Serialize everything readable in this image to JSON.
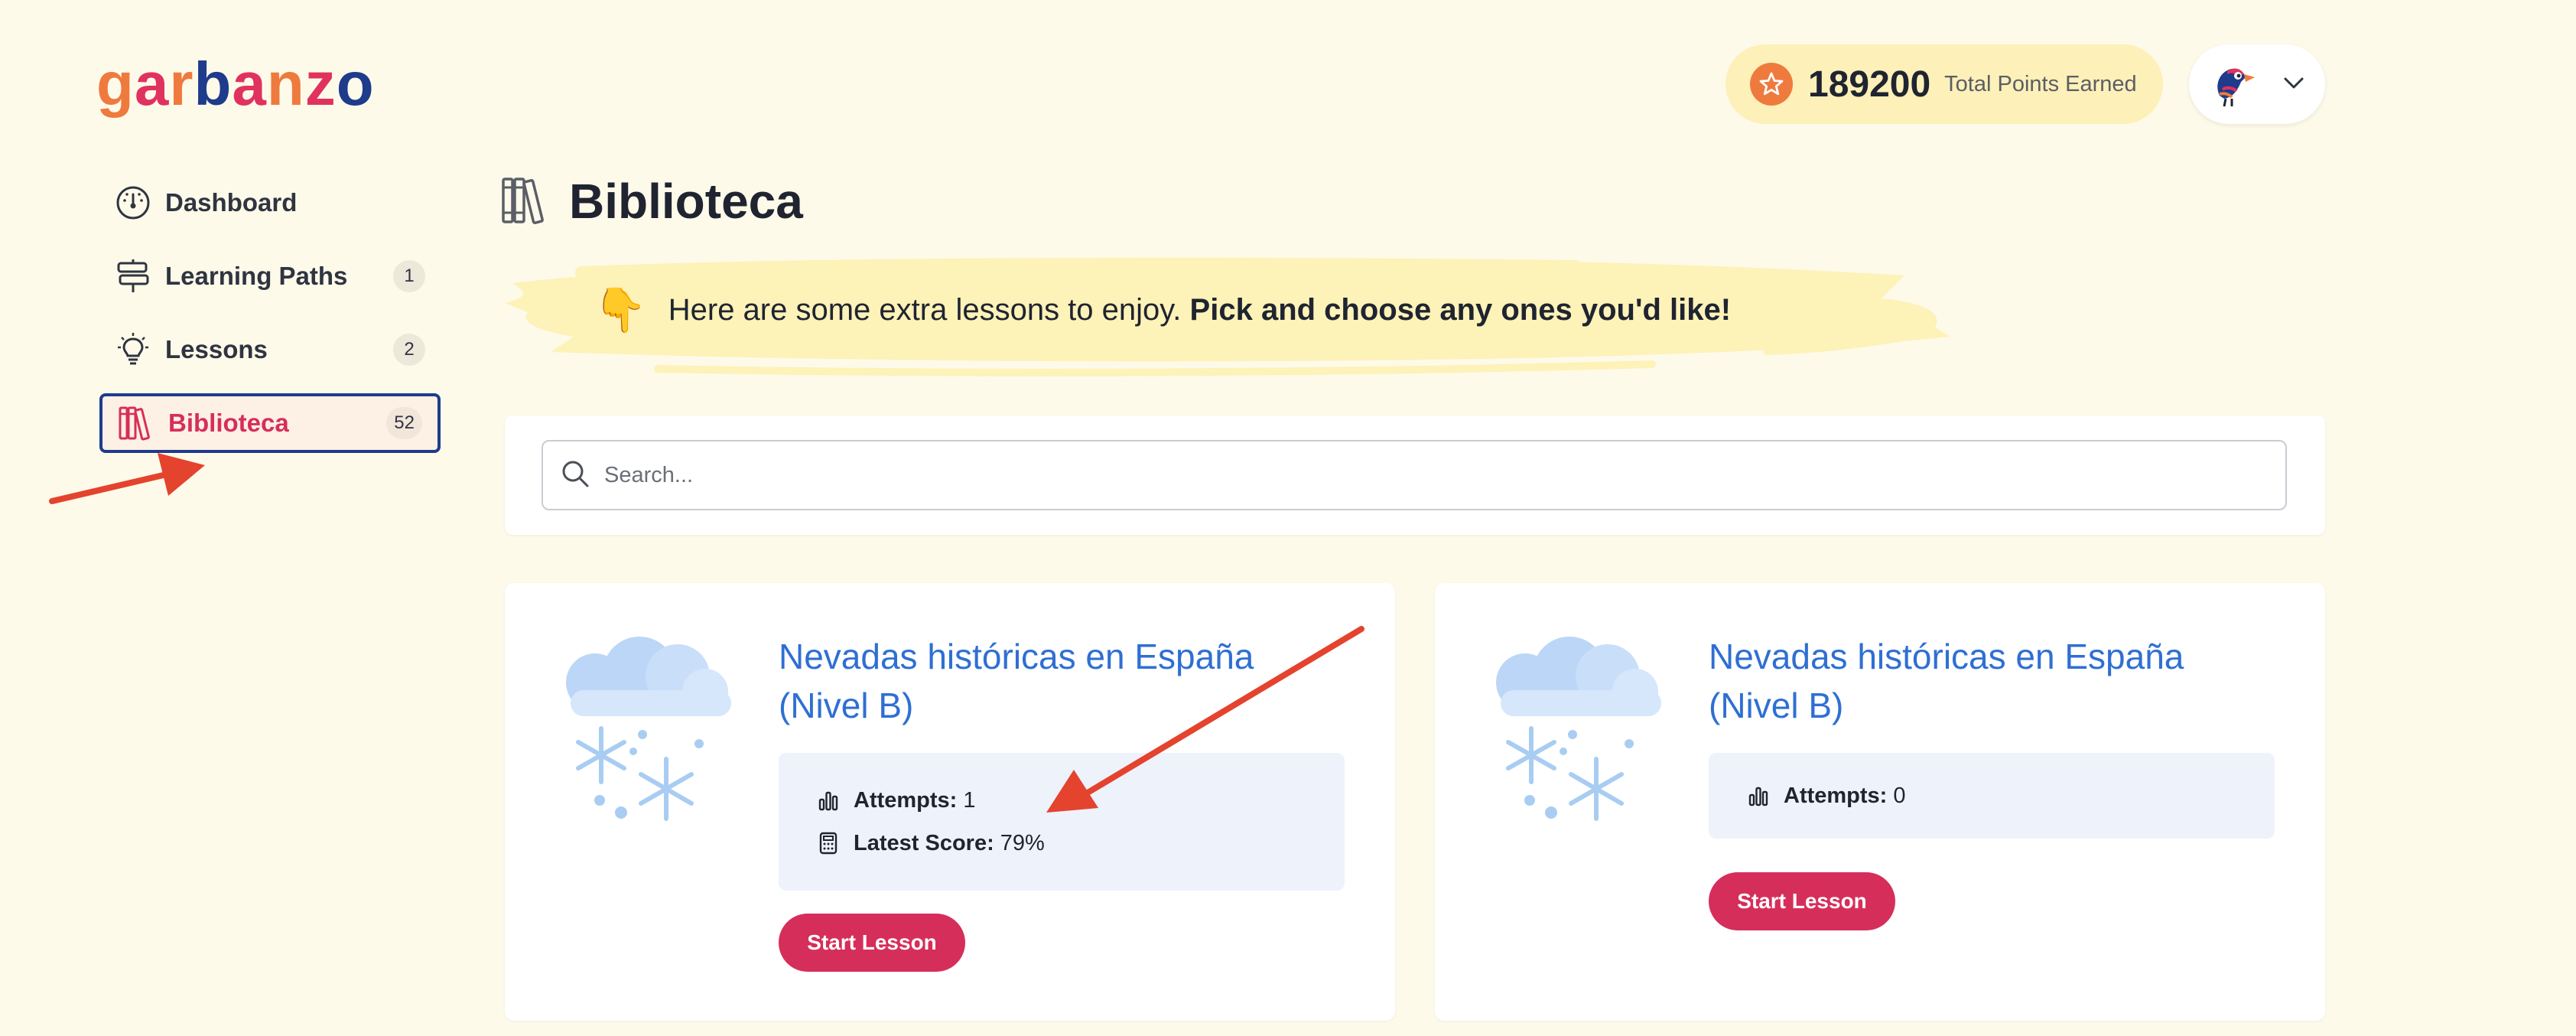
{
  "logo": {
    "letters": [
      {
        "ch": "g",
        "color": "#ef7a3d"
      },
      {
        "ch": "a",
        "color": "#e0325f"
      },
      {
        "ch": "r",
        "color": "#ef7a3d"
      },
      {
        "ch": "b",
        "color": "#1e3b8c"
      },
      {
        "ch": "a",
        "color": "#e0325f"
      },
      {
        "ch": "n",
        "color": "#ef7a3d"
      },
      {
        "ch": "z",
        "color": "#e0325f"
      },
      {
        "ch": "o",
        "color": "#1e3b8c"
      }
    ]
  },
  "sidebar": {
    "items": [
      {
        "label": "Dashboard",
        "icon": "dashboard-gauge-icon",
        "count": ""
      },
      {
        "label": "Learning Paths",
        "icon": "signpost-icon",
        "count": "1"
      },
      {
        "label": "Lessons",
        "icon": "lightbulb-icon",
        "count": "2"
      },
      {
        "label": "Biblioteca",
        "icon": "books-icon",
        "count": "52",
        "active": true
      }
    ]
  },
  "header": {
    "points_value": "189200",
    "points_label": "Total Points Earned",
    "points_icon": "star-icon",
    "avatar_icon": "bird-avatar-icon",
    "menu_icon": "chevron-down-icon"
  },
  "page": {
    "title": "Biblioteca",
    "title_icon": "books-icon",
    "banner_hand": "👇",
    "banner_text": "Here are some extra lessons to enjoy.",
    "banner_bold": "Pick and choose any ones you'd like!"
  },
  "search": {
    "placeholder": "Search...",
    "value": ""
  },
  "lessons": [
    {
      "title": "Nevadas históricas en España (Nivel B)",
      "illustration": "snow-cloud-icon",
      "attempts_label": "Attempts:",
      "attempts_value": "1",
      "score_label": "Latest Score:",
      "score_value": "79%",
      "button": "Start Lesson"
    },
    {
      "title": "Nevadas históricas en España (Nivel B)",
      "illustration": "snow-cloud-icon",
      "attempts_label": "Attempts:",
      "attempts_value": "0",
      "button": "Start Lesson"
    }
  ],
  "colors": {
    "background": "#fefaea",
    "accent": "#d62e5a",
    "link_blue": "#2f6fd3",
    "active_border": "#1e3b8c",
    "annotation_arrow": "#e4432d"
  }
}
